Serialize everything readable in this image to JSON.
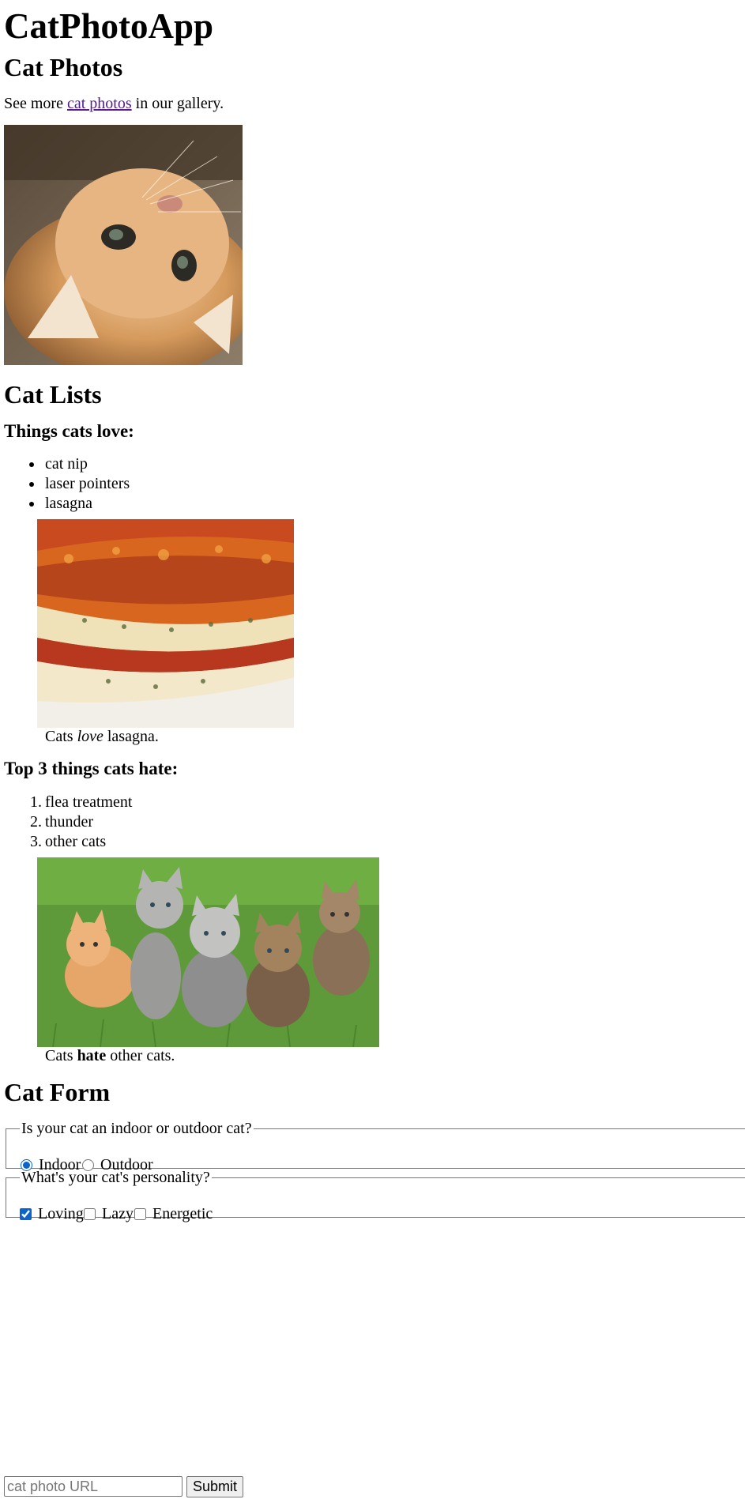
{
  "app_title": "CatPhotoApp",
  "photos_section": {
    "heading": "Cat Photos",
    "intro_prefix": "See more ",
    "intro_link": "cat photos",
    "intro_suffix": " in our gallery."
  },
  "lists_section": {
    "heading": "Cat Lists",
    "love": {
      "heading": "Things cats love:",
      "items": [
        "cat nip",
        "laser pointers",
        "lasagna"
      ],
      "caption_prefix": "Cats ",
      "caption_emphasis": "love",
      "caption_suffix": " lasagna."
    },
    "hate": {
      "heading": "Top 3 things cats hate:",
      "items": [
        "flea treatment",
        "thunder",
        "other cats"
      ],
      "markers": [
        "1.",
        "2.",
        "3."
      ],
      "caption_prefix": "Cats ",
      "caption_emphasis": "hate",
      "caption_suffix": " other cats."
    }
  },
  "form_section": {
    "heading": "Cat Form",
    "location": {
      "legend": "Is your cat an indoor or outdoor cat?",
      "options": [
        {
          "label": "Indoor",
          "checked": true
        },
        {
          "label": "Outdoor",
          "checked": false
        }
      ]
    },
    "personality": {
      "legend": "What's your cat's personality?",
      "options": [
        {
          "label": "Loving",
          "checked": true
        },
        {
          "label": "Lazy",
          "checked": false
        },
        {
          "label": "Energetic",
          "checked": false
        }
      ]
    },
    "url_placeholder": "cat photo URL",
    "submit_label": "Submit"
  },
  "colors": {
    "link": "#551a8b",
    "accent": "#0b63ce"
  }
}
